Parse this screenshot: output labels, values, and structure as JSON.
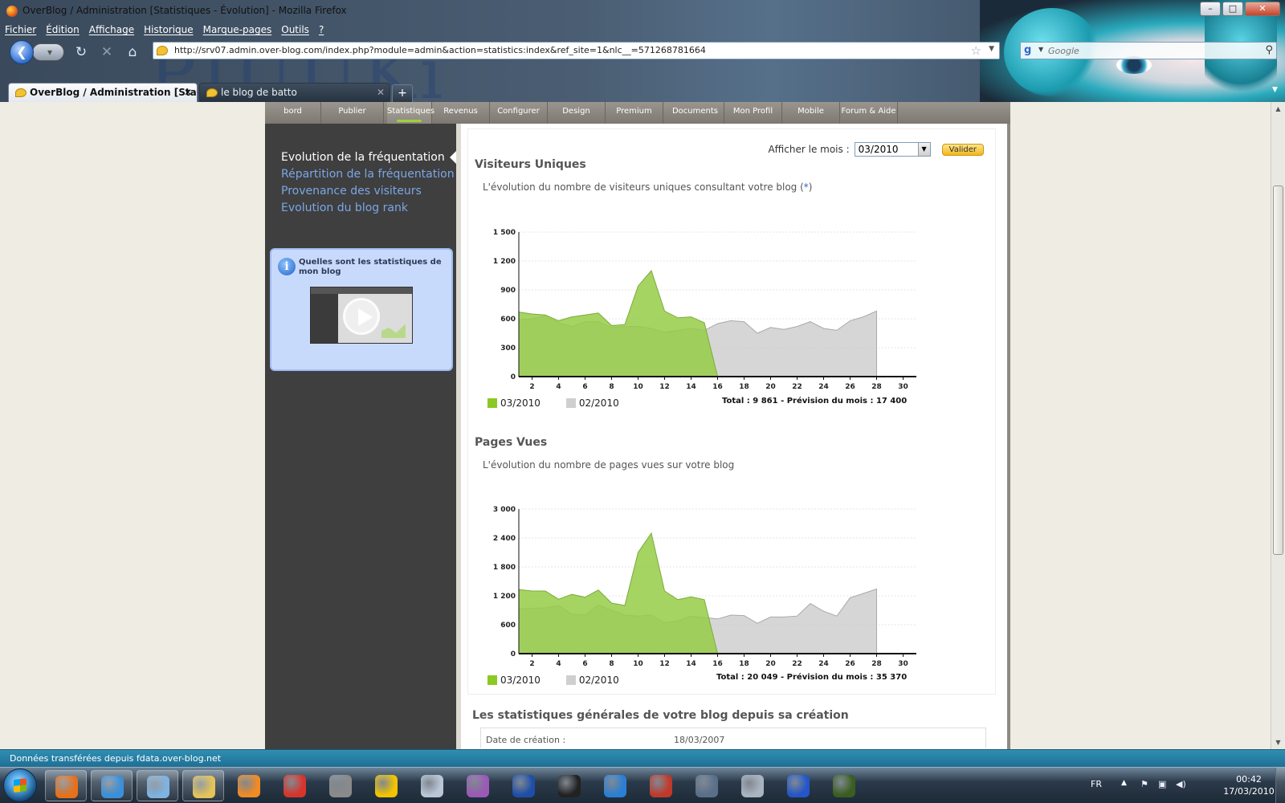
{
  "window": {
    "title": "OverBlog / Administration [Statistiques - Évolution] - Mozilla Firefox",
    "buttons": {
      "minimize": "–",
      "maximize": "□",
      "close": "✕"
    }
  },
  "menu": [
    "Fichier",
    "Édition",
    "Affichage",
    "Historique",
    "Marque-pages",
    "Outils",
    "?"
  ],
  "navbar": {
    "url": "http://srv07.admin.over-blog.com/index.php?module=admin&action=statistics:index&ref_site=1&nlc__=571268781664",
    "search_placeholder": "Google"
  },
  "tabs": [
    {
      "label": "OverBlog / Administration [Statis...",
      "active": true
    },
    {
      "label": "le blog de batto",
      "active": false
    }
  ],
  "background_logo": "PIUUKi",
  "site_nav": [
    "bord",
    "Publier",
    "Statistiques",
    "Revenus",
    "Configurer",
    "Design",
    "Premium",
    "Documents",
    "Mon Profil",
    "Mobile",
    "Forum & Aide"
  ],
  "site_nav_active": "Statistiques",
  "sub_menu": [
    {
      "label": "Evolution de la fréquentation",
      "active": true
    },
    {
      "label": "Répartition de la fréquentation",
      "active": false
    },
    {
      "label": "Provenance des visiteurs",
      "active": false
    },
    {
      "label": "Evolution du blog rank",
      "active": false
    }
  ],
  "help_box": {
    "title": "Quelles sont les statistiques de mon blog"
  },
  "month_form": {
    "label": "Afficher le mois :",
    "value": "03/2010",
    "button": "Valider"
  },
  "sections": {
    "visitors": {
      "title": "Visiteurs Uniques",
      "desc": "L'évolution du nombre de visiteurs uniques consultant votre blog (",
      "asterisk": "*",
      "desc_end": ")",
      "total": "Total : 9 861 - Prévision du mois : 17 400"
    },
    "pageviews": {
      "title": "Pages Vues",
      "desc": "L'évolution du nombre de pages vues sur votre blog",
      "total": "Total : 20 049 - Prévision du mois : 35 370"
    }
  },
  "legend": {
    "current": "03/2010",
    "previous": "02/2010"
  },
  "colors": {
    "current": "#9ed13a",
    "previous": "#d6d6d6",
    "accent_link": "#7ba6e6",
    "statusbar": "#2a83aa"
  },
  "chart_data": [
    {
      "type": "area",
      "title": "Visiteurs Uniques",
      "xlabel": "",
      "ylabel": "",
      "x": [
        1,
        2,
        3,
        4,
        5,
        6,
        7,
        8,
        9,
        10,
        11,
        12,
        13,
        14,
        15,
        16,
        17,
        18,
        19,
        20,
        21,
        22,
        23,
        24,
        25,
        26,
        27,
        28
      ],
      "x_ticks": [
        2,
        4,
        6,
        8,
        10,
        12,
        14,
        16,
        18,
        20,
        22,
        24,
        26,
        28,
        30
      ],
      "y_ticks": [
        "0",
        "300",
        "600",
        "900",
        "1 200",
        "1 500"
      ],
      "xlim": [
        1,
        31
      ],
      "ylim": [
        0,
        1500
      ],
      "grid": true,
      "series": [
        {
          "name": "03/2010",
          "x": [
            1,
            2,
            3,
            4,
            5,
            6,
            7,
            8,
            9,
            10,
            11,
            12,
            13,
            14,
            15,
            16
          ],
          "values": [
            670,
            650,
            640,
            580,
            620,
            640,
            660,
            530,
            540,
            940,
            1100,
            680,
            610,
            620,
            560,
            0
          ]
        },
        {
          "name": "02/2010",
          "x": [
            1,
            2,
            3,
            4,
            5,
            6,
            7,
            8,
            9,
            10,
            11,
            12,
            13,
            14,
            15,
            16,
            17,
            18,
            19,
            20,
            21,
            22,
            23,
            24,
            25,
            26,
            27,
            28
          ],
          "values": [
            590,
            600,
            630,
            560,
            520,
            570,
            570,
            510,
            520,
            520,
            500,
            460,
            480,
            500,
            480,
            550,
            580,
            570,
            450,
            510,
            490,
            520,
            570,
            500,
            480,
            580,
            620,
            680
          ]
        }
      ]
    },
    {
      "type": "area",
      "title": "Pages Vues",
      "xlabel": "",
      "ylabel": "",
      "x": [
        1,
        2,
        3,
        4,
        5,
        6,
        7,
        8,
        9,
        10,
        11,
        12,
        13,
        14,
        15,
        16,
        17,
        18,
        19,
        20,
        21,
        22,
        23,
        24,
        25,
        26,
        27,
        28
      ],
      "x_ticks": [
        2,
        4,
        6,
        8,
        10,
        12,
        14,
        16,
        18,
        20,
        22,
        24,
        26,
        28,
        30
      ],
      "y_ticks": [
        "0",
        "600",
        "1 200",
        "1 800",
        "2 400",
        "3 000"
      ],
      "xlim": [
        1,
        31
      ],
      "ylim": [
        0,
        3000
      ],
      "grid": true,
      "series": [
        {
          "name": "03/2010",
          "x": [
            1,
            2,
            3,
            4,
            5,
            6,
            7,
            8,
            9,
            10,
            11,
            12,
            13,
            14,
            15,
            16
          ],
          "values": [
            1330,
            1300,
            1300,
            1130,
            1230,
            1170,
            1320,
            1050,
            1000,
            2100,
            2500,
            1300,
            1120,
            1180,
            1120,
            0
          ]
        },
        {
          "name": "02/2010",
          "x": [
            1,
            2,
            3,
            4,
            5,
            6,
            7,
            8,
            9,
            10,
            11,
            12,
            13,
            14,
            15,
            16,
            17,
            18,
            19,
            20,
            21,
            22,
            23,
            24,
            25,
            26,
            27,
            28
          ],
          "values": [
            930,
            940,
            950,
            1000,
            820,
            800,
            1010,
            900,
            800,
            780,
            800,
            640,
            680,
            780,
            750,
            720,
            800,
            790,
            630,
            760,
            760,
            780,
            1040,
            880,
            780,
            1160,
            1250,
            1340
          ]
        }
      ]
    }
  ],
  "general": {
    "title": "Les statistiques générales de votre blog depuis sa création",
    "rows": [
      {
        "key": "Date de création :",
        "value": "18/03/2007"
      }
    ]
  },
  "statusbar": "Données transférées depuis fdata.over-blog.net",
  "tray": {
    "lang": "FR",
    "time": "00:42",
    "date": "17/03/2010"
  },
  "taskbar_apps": [
    "firefox-icon",
    "users-icon",
    "presentation-icon",
    "folder-icon",
    "media-player-icon",
    "flash-icon",
    "film-icon",
    "game-2-icon",
    "robot-icon",
    "pinwheel-icon",
    "flame-icon",
    "steam-icon",
    "sync-icon",
    "card-icon",
    "speed-icon",
    "gamepad-icon",
    "sonic-icon",
    "game-cover-icon"
  ]
}
